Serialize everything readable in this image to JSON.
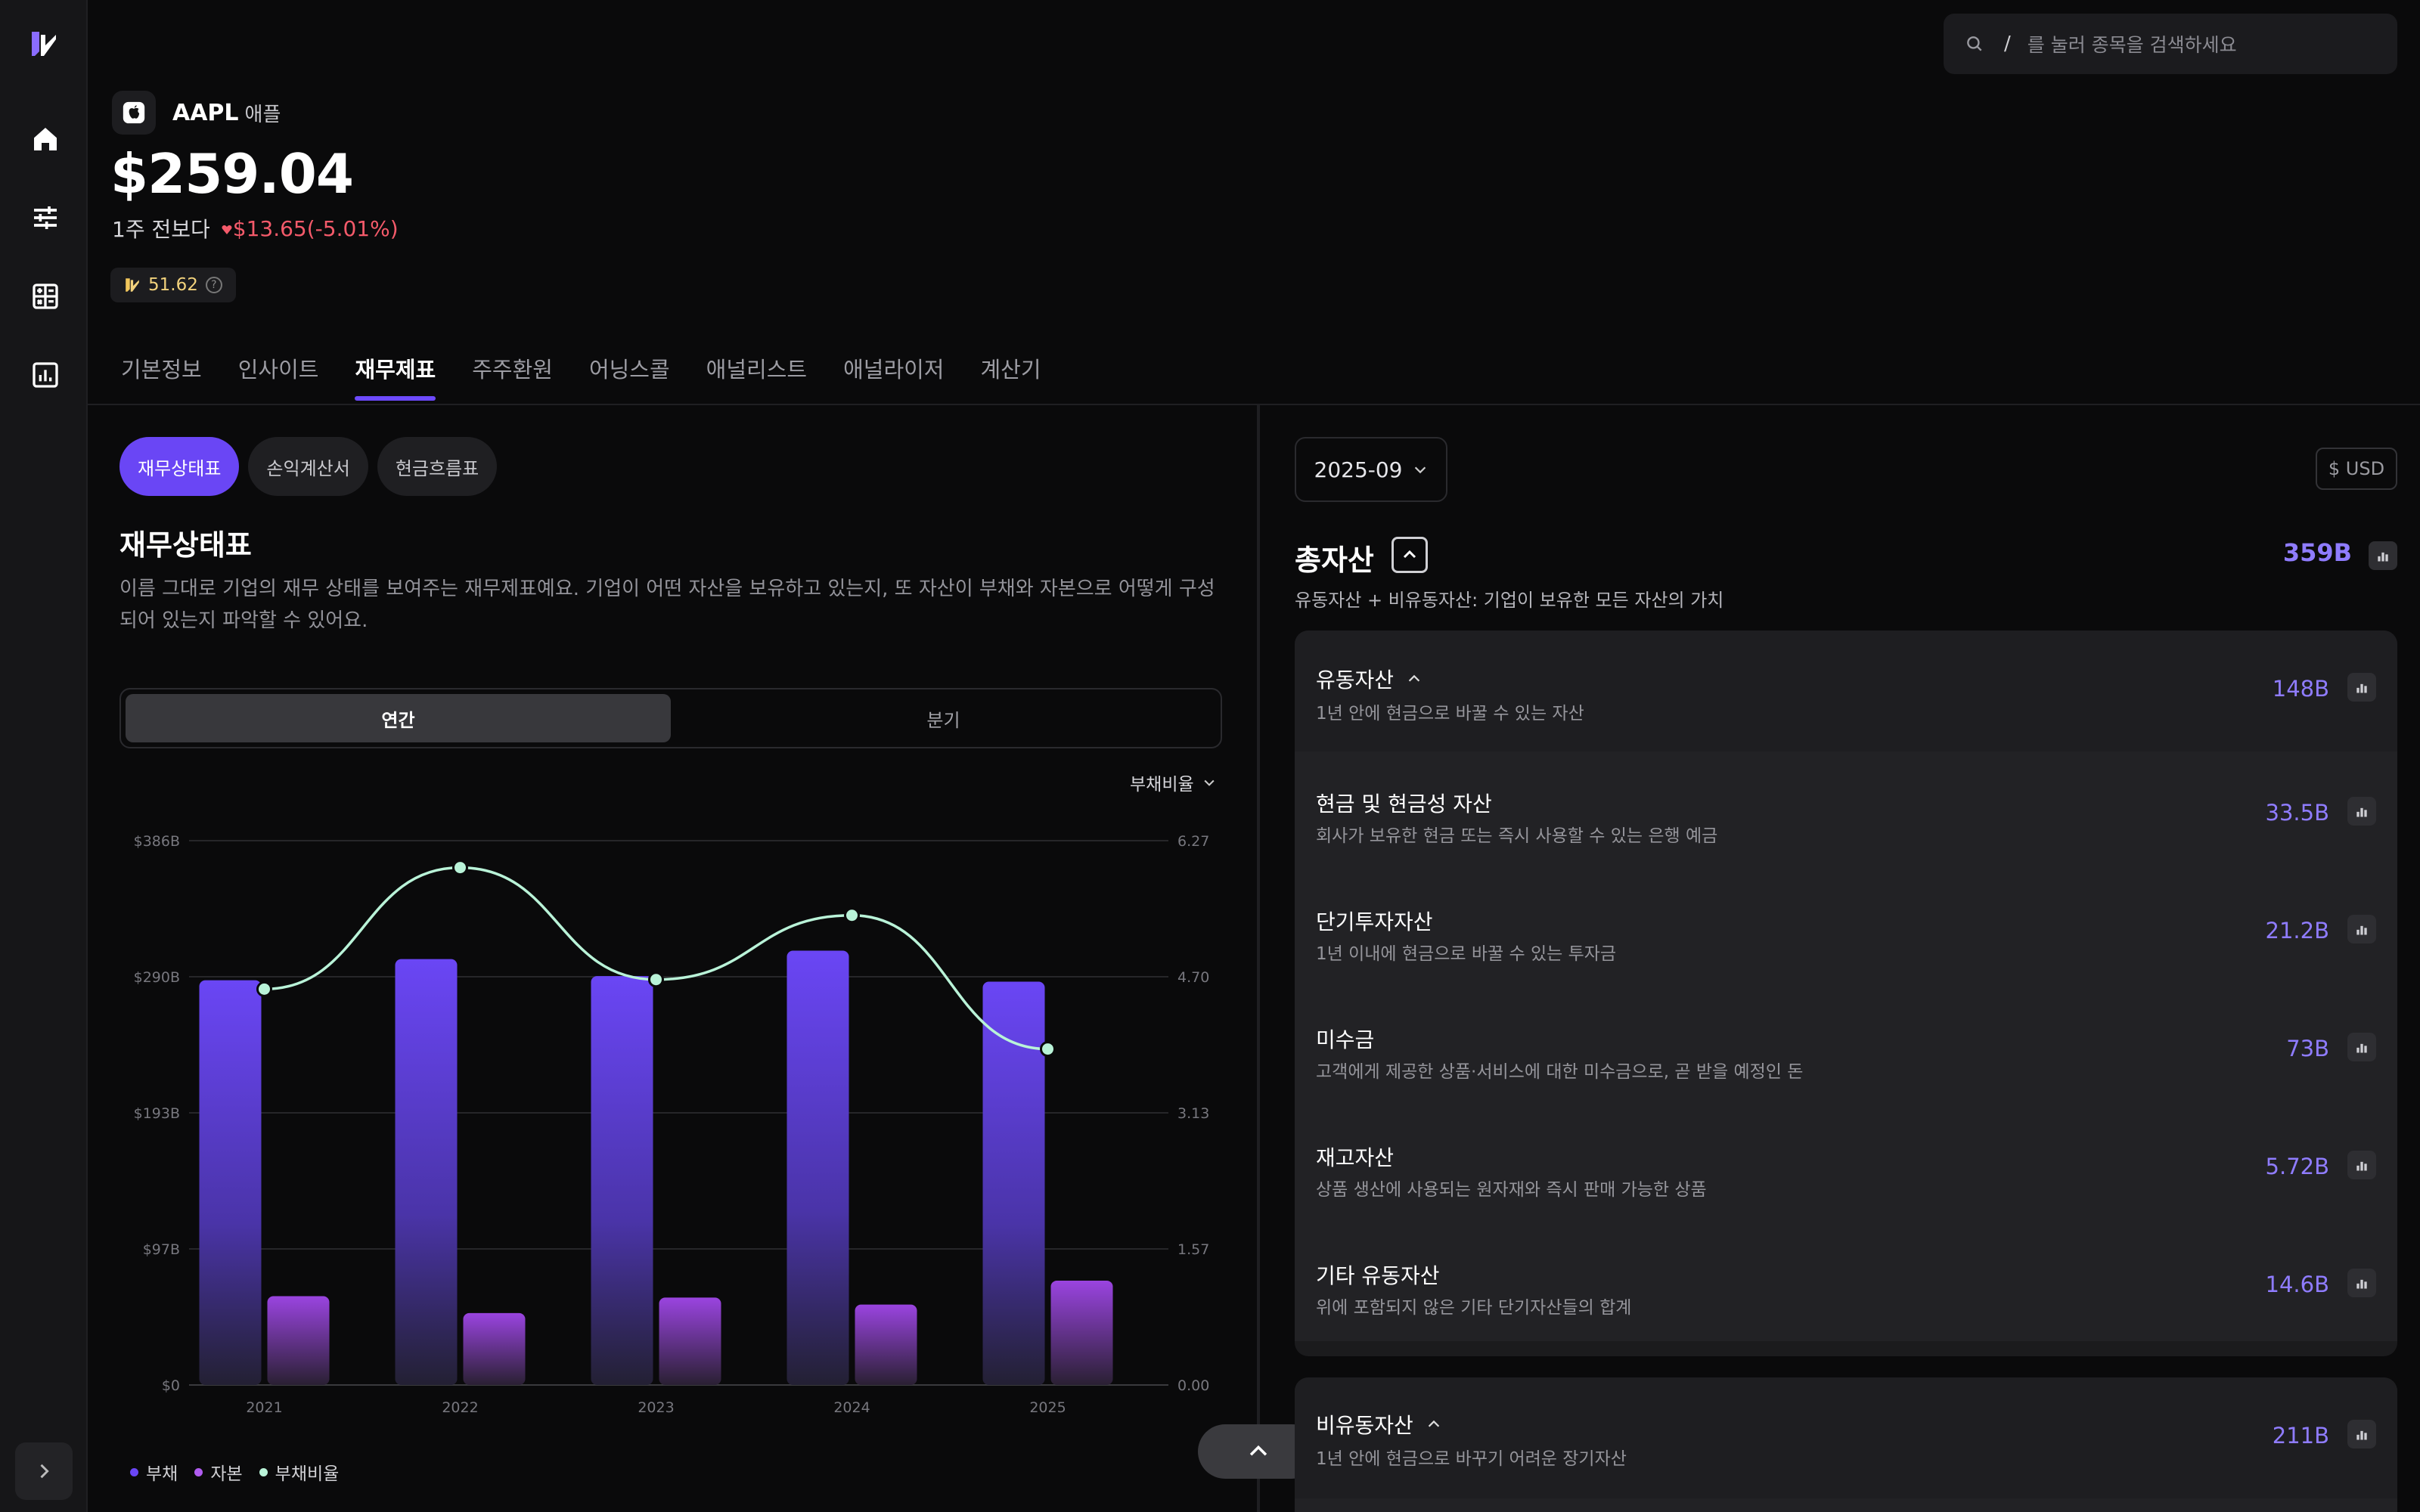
{
  "search": {
    "shortcut": "/",
    "placeholder": "를 눌러 종목을 검색하세요"
  },
  "stock": {
    "symbol": "AAPL",
    "name": "애플",
    "price": "$259.04",
    "period": "1주 전보다",
    "change": "$13.65(-5.01%)",
    "score": "51.62"
  },
  "tabs": [
    "기본정보",
    "인사이트",
    "재무제표",
    "주주환원",
    "어닝스콜",
    "애널리스트",
    "애널라이저",
    "계산기"
  ],
  "active_tab": "재무제표",
  "statement_chips": [
    "재무상태표",
    "손익계산서",
    "현금흐름표"
  ],
  "section": {
    "title": "재무상태표",
    "description": "이름 그대로 기업의 재무 상태를 보여주는 재무제표예요. 기업이 어떤 자산을 보유하고 있는지, 또 자산이 부채와 자본으로 어떻게 구성되어 있는지 파악할 수 있어요."
  },
  "period_toggle": {
    "annual": "연간",
    "quarter": "분기"
  },
  "ratio_select": "부채비율",
  "chart_data": {
    "type": "bar",
    "categories": [
      "2021",
      "2022",
      "2023",
      "2024",
      "2025"
    ],
    "y_ticks": [
      "$386B",
      "$290B",
      "$193B",
      "$97B",
      "$0"
    ],
    "y2_ticks": [
      "6.27",
      "4.70",
      "3.13",
      "1.57",
      "0.00"
    ],
    "ylim": [
      0,
      386
    ],
    "y2lim": [
      0,
      6.27
    ],
    "series": [
      {
        "name": "부채",
        "values": [
          287,
          302,
          290,
          308,
          286
        ],
        "color": "#6a46f5"
      },
      {
        "name": "자본",
        "values": [
          63,
          51,
          62,
          57,
          74
        ],
        "color": "#9a44e0"
      },
      {
        "name": "부채비율",
        "values": [
          4.56,
          5.96,
          4.67,
          5.41,
          3.87
        ],
        "color": "#b9f3d8",
        "type": "line",
        "axis": "right"
      }
    ]
  },
  "right": {
    "date": "2025-09",
    "currency": "$ USD",
    "total": {
      "title": "총자산",
      "value": "359B",
      "desc": "유동자산 + 비유동자산: 기업이 보유한 모든 자산의 가치"
    },
    "current_assets": {
      "title": "유동자산",
      "desc": "1년 안에 현금으로 바꿀 수 있는 자산",
      "value": "148B",
      "items": [
        {
          "title": "현금 및 현금성 자산",
          "desc": "회사가 보유한 현금 또는 즉시 사용할 수 있는 은행 예금",
          "value": "33.5B"
        },
        {
          "title": "단기투자자산",
          "desc": "1년 이내에 현금으로 바꿀 수 있는 투자금",
          "value": "21.2B"
        },
        {
          "title": "미수금",
          "desc": "고객에게 제공한 상품·서비스에 대한 미수금으로, 곧 받을 예정인 돈",
          "value": "73B"
        },
        {
          "title": "재고자산",
          "desc": "상품 생산에 사용되는 원자재와 즉시 판매 가능한 상품",
          "value": "5.72B"
        },
        {
          "title": "기타 유동자산",
          "desc": "위에 포함되지 않은 기타 단기자산들의 합계",
          "value": "14.6B"
        }
      ]
    },
    "noncurrent_assets": {
      "title": "비유동자산",
      "desc": "1년 안에 현금으로 바꾸기 어려운 장기자산",
      "value": "211B"
    }
  },
  "colors": {
    "accent": "#6d4aff",
    "down": "#f45a6a",
    "value": "#8f7cff"
  }
}
